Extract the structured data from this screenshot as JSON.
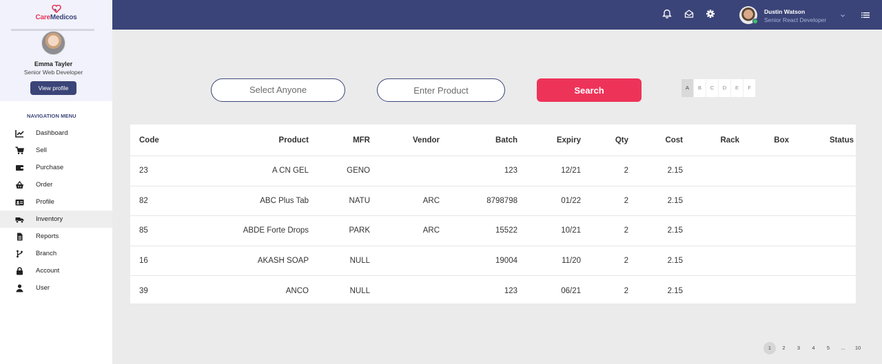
{
  "brand": {
    "part1": "Care",
    "part2": "Medicos"
  },
  "sidebar_user": {
    "name": "Emma Tayler",
    "role": "Senior Web Developer",
    "button": "View profile"
  },
  "nav": {
    "title": "NAVIGATION MENU",
    "items": [
      {
        "label": "Dashboard",
        "icon": "chart-line-icon"
      },
      {
        "label": "Sell",
        "icon": "cart-icon"
      },
      {
        "label": "Purchase",
        "icon": "wallet-icon"
      },
      {
        "label": "Order",
        "icon": "basket-icon"
      },
      {
        "label": "Profile",
        "icon": "id-card-icon"
      },
      {
        "label": "Inventory",
        "icon": "truck-icon",
        "active": true
      },
      {
        "label": "Reports",
        "icon": "file-icon"
      },
      {
        "label": "Branch",
        "icon": "branch-icon"
      },
      {
        "label": "Account",
        "icon": "lock-icon"
      },
      {
        "label": "User",
        "icon": "user-icon"
      }
    ]
  },
  "header": {
    "user_name": "Dustin Watson",
    "user_role": "Senior React Developer",
    "icons": [
      "bell-icon",
      "envelope-icon",
      "gear-icon",
      "chevron-down-icon",
      "list-menu-icon"
    ]
  },
  "filters": {
    "select_placeholder": "Select Anyone",
    "product_placeholder": "Enter Product",
    "search_label": "Search"
  },
  "alphabet": {
    "letters": [
      "A",
      "B",
      "C",
      "D",
      "E",
      "F"
    ],
    "active": "A"
  },
  "table": {
    "columns": [
      "Code",
      "Product",
      "MFR",
      "Vendor",
      "Batch",
      "Expiry",
      "Qty",
      "Cost",
      "Rack",
      "Box",
      "Status"
    ],
    "rows": [
      {
        "code": "23",
        "product": "A CN GEL",
        "mfr": "GENO",
        "vendor": "",
        "batch": "123",
        "expiry": "12/21",
        "qty": "2",
        "cost": "2.15",
        "rack": "",
        "box": "",
        "status": ""
      },
      {
        "code": "82",
        "product": "ABC Plus Tab",
        "mfr": "NATU",
        "vendor": "ARC",
        "batch": "8798798",
        "expiry": "01/22",
        "qty": "2",
        "cost": "2.15",
        "rack": "",
        "box": "",
        "status": ""
      },
      {
        "code": "85",
        "product": "ABDE Forte Drops",
        "mfr": "PARK",
        "vendor": "ARC",
        "batch": "15522",
        "expiry": "10/21",
        "qty": "2",
        "cost": "2.15",
        "rack": "",
        "box": "",
        "status": ""
      },
      {
        "code": "16",
        "product": "AKASH SOAP",
        "mfr": "NULL",
        "vendor": "",
        "batch": "19004",
        "expiry": "11/20",
        "qty": "2",
        "cost": "2.15",
        "rack": "",
        "box": "",
        "status": ""
      },
      {
        "code": "39",
        "product": "ANCO",
        "mfr": "NULL",
        "vendor": "",
        "batch": "123",
        "expiry": "06/21",
        "qty": "2",
        "cost": "2.15",
        "rack": "",
        "box": "",
        "status": ""
      }
    ]
  },
  "pagination": {
    "pages": [
      "1",
      "2",
      "3",
      "4",
      "5",
      "...",
      "10"
    ],
    "current": "1"
  },
  "colors": {
    "primary": "#3b4478",
    "accent": "#ee3359",
    "background": "#ebebeb"
  }
}
